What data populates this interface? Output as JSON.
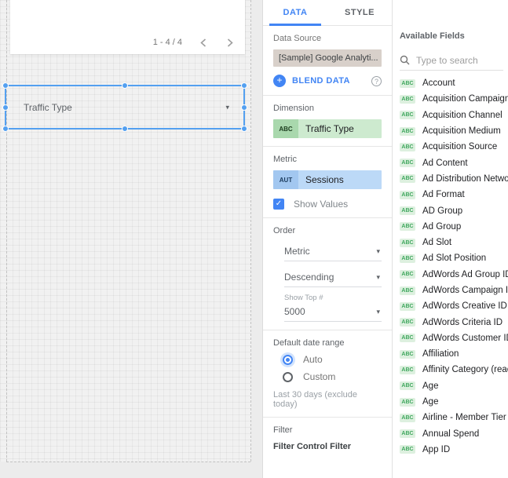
{
  "canvas": {
    "pagination": {
      "label": "1 - 4 / 4"
    },
    "selected_control": {
      "label": "Traffic Type",
      "caret": "▾"
    }
  },
  "panel": {
    "tabs": [
      {
        "label": "DATA",
        "active": true
      },
      {
        "label": "STYLE",
        "active": false
      }
    ],
    "data_source": {
      "section_label": "Data Source",
      "name": "[Sample] Google Analyti...",
      "blend_label": "BLEND DATA",
      "help_glyph": "?",
      "plus_glyph": "+"
    },
    "dimension": {
      "section_label": "Dimension",
      "chip": {
        "badge": "ABC",
        "label": "Traffic Type"
      }
    },
    "metric": {
      "section_label": "Metric",
      "chip": {
        "badge": "AUT",
        "label": "Sessions"
      },
      "show_values_label": "Show Values",
      "show_values_checked": true,
      "check_glyph": "✓"
    },
    "order": {
      "section_label": "Order",
      "sort_field": "Metric",
      "sort_direction": "Descending",
      "show_top_label": "Show Top #",
      "show_top_value": "5000",
      "caret": "▾"
    },
    "date_range": {
      "section_label": "Default date range",
      "options": [
        {
          "label": "Auto",
          "selected": true
        },
        {
          "label": "Custom",
          "selected": false
        }
      ],
      "summary": "Last 30 days (exclude today)"
    },
    "filter": {
      "section_label": "Filter",
      "sub_label": "Filter Control Filter"
    }
  },
  "fields": {
    "title": "Available Fields",
    "search_placeholder": "Type to search",
    "items": [
      {
        "badge": "ABC",
        "label": "Account"
      },
      {
        "badge": "ABC",
        "label": "Acquisition Campaign"
      },
      {
        "badge": "ABC",
        "label": "Acquisition Channel"
      },
      {
        "badge": "ABC",
        "label": "Acquisition Medium"
      },
      {
        "badge": "ABC",
        "label": "Acquisition Source"
      },
      {
        "badge": "ABC",
        "label": "Ad Content"
      },
      {
        "badge": "ABC",
        "label": "Ad Distribution Netwo..."
      },
      {
        "badge": "ABC",
        "label": "Ad Format"
      },
      {
        "badge": "ABC",
        "label": "AD Group"
      },
      {
        "badge": "ABC",
        "label": "Ad Group"
      },
      {
        "badge": "ABC",
        "label": "Ad Slot"
      },
      {
        "badge": "ABC",
        "label": "Ad Slot Position"
      },
      {
        "badge": "ABC",
        "label": "AdWords Ad Group ID"
      },
      {
        "badge": "ABC",
        "label": "AdWords Campaign ID"
      },
      {
        "badge": "ABC",
        "label": "AdWords Creative ID"
      },
      {
        "badge": "ABC",
        "label": "AdWords Criteria ID"
      },
      {
        "badge": "ABC",
        "label": "AdWords Customer ID"
      },
      {
        "badge": "ABC",
        "label": "Affiliation"
      },
      {
        "badge": "ABC",
        "label": "Affinity Category (reac..."
      },
      {
        "badge": "ABC",
        "label": "Age"
      },
      {
        "badge": "ABC",
        "label": "Age"
      },
      {
        "badge": "ABC",
        "label": "Airline - Member Tier"
      },
      {
        "badge": "ABC",
        "label": "Annual Spend"
      },
      {
        "badge": "ABC",
        "label": "App ID"
      }
    ]
  },
  "colors": {
    "accent_blue": "#4285f4",
    "selection_blue": "#54a0f0",
    "dimension_green": "#cdeacf",
    "dimension_badge_green": "#a9d8ad",
    "metric_blue": "#bcd9f7",
    "metric_badge_blue": "#a2c7f0",
    "data_source_chip": "#d8d0ca",
    "field_badge_green": "#41a85f",
    "canvas_grid": "#f1f1f1"
  }
}
